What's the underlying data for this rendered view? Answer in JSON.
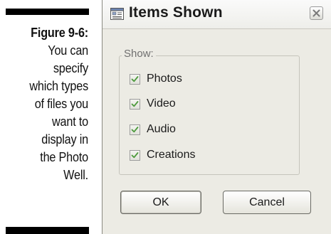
{
  "caption": {
    "figure_label": "Figure 9-6:",
    "lines": [
      "You can",
      "specify",
      "which types",
      "of files you",
      "want to",
      "display in",
      "the Photo",
      "Well."
    ]
  },
  "dialog": {
    "title": "Items Shown",
    "title_icon": "window-list-icon",
    "close_icon": "close-icon",
    "group_label": "Show:",
    "options": [
      {
        "label": "Photos",
        "checked": true
      },
      {
        "label": "Video",
        "checked": true
      },
      {
        "label": "Audio",
        "checked": true
      },
      {
        "label": "Creations",
        "checked": true
      }
    ],
    "ok_label": "OK",
    "cancel_label": "Cancel"
  },
  "colors": {
    "dialog_bg": "#ecebe4",
    "check_green": "#4c9a3c",
    "rule_black": "#000000"
  }
}
